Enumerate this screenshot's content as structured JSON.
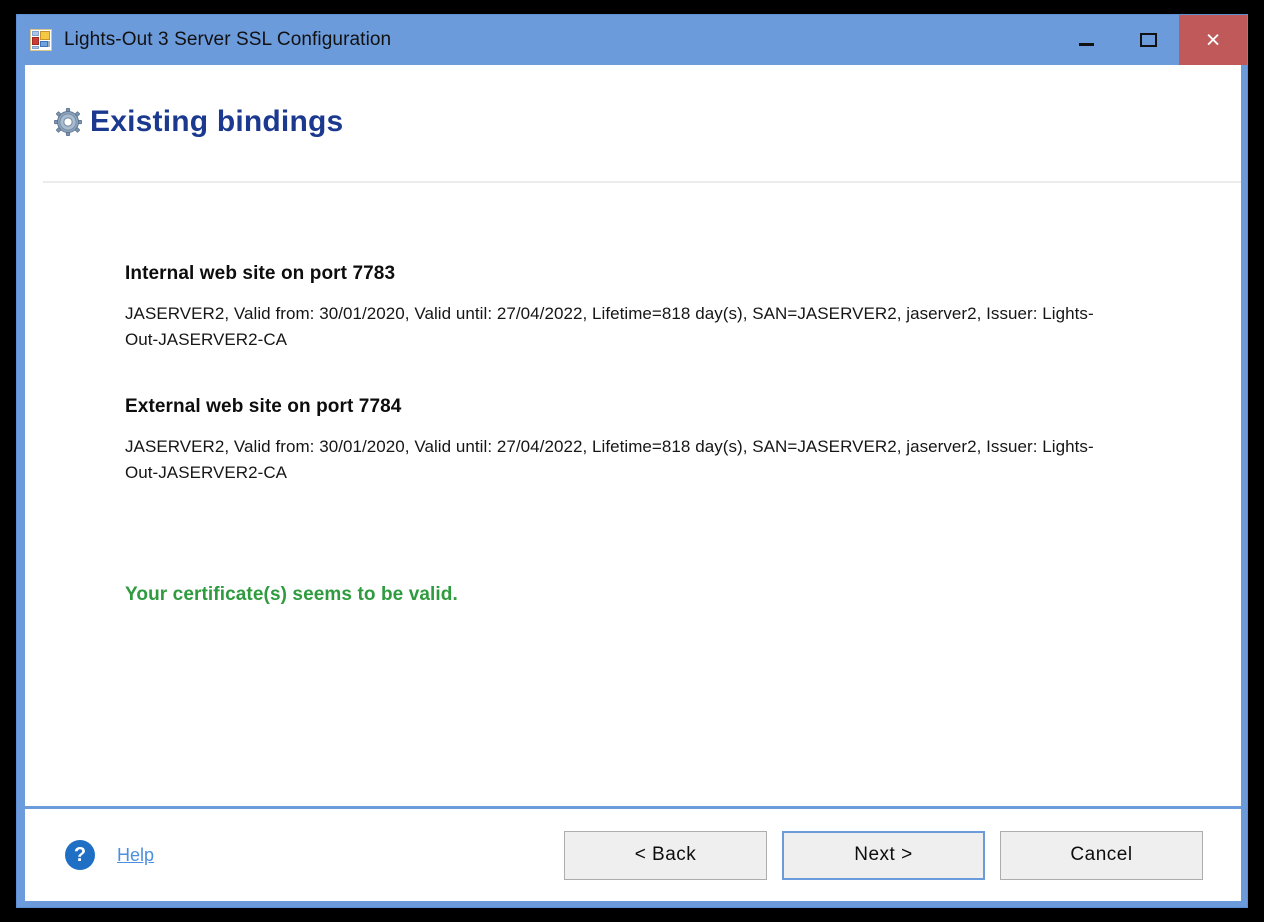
{
  "window": {
    "title": "Lights-Out 3 Server SSL Configuration",
    "icon": "form-designer-icon",
    "controls": {
      "minimize": "minimize-glyph",
      "maximize": "maximize-glyph",
      "close": "×"
    },
    "titlebar_color": "#6c9bdc",
    "close_button_color": "#c05a5a"
  },
  "header": {
    "icon": "gear-icon",
    "title": "Existing bindings",
    "title_color": "#1b3a8f"
  },
  "main": {
    "bindings": [
      {
        "title": "Internal web site on port 7783",
        "detail": "JASERVER2, Valid from: 30/01/2020, Valid until: 27/04/2022, Lifetime=818 day(s), SAN=JASERVER2, jaserver2, Issuer: Lights-Out-JASERVER2-CA"
      },
      {
        "title": "External web site on port 7784",
        "detail": "JASERVER2, Valid from: 30/01/2020, Valid until: 27/04/2022, Lifetime=818 day(s), SAN=JASERVER2, jaserver2, Issuer: Lights-Out-JASERVER2-CA"
      }
    ],
    "status": {
      "text": "Your certificate(s) seems to be valid.",
      "color": "#2e9b3e"
    }
  },
  "footer": {
    "help_icon": "?",
    "help_label": "Help",
    "help_color": "#4a8fe0",
    "buttons": [
      {
        "label": "< Back",
        "default": false
      },
      {
        "label": "Next >",
        "default": true
      },
      {
        "label": "Cancel",
        "default": false
      }
    ]
  }
}
